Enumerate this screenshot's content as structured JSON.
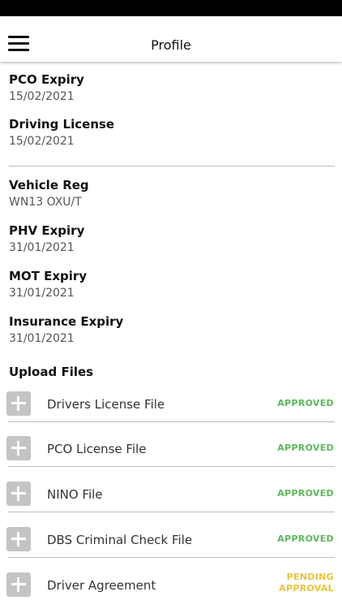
{
  "header": {
    "title": "Profile"
  },
  "driver_fields": [
    {
      "label": "PCO Expiry",
      "value": "15/02/2021"
    },
    {
      "label": "Driving License",
      "value": "15/02/2021"
    }
  ],
  "vehicle_fields": [
    {
      "label": "Vehicle Reg",
      "value": "WN13 OXU/T"
    },
    {
      "label": "PHV Expiry",
      "value": "31/01/2021"
    },
    {
      "label": "MOT Expiry",
      "value": "31/01/2021"
    },
    {
      "label": "Insurance Expiry",
      "value": "31/01/2021"
    }
  ],
  "upload": {
    "title": "Upload Files",
    "files": [
      {
        "name": "Drivers License File",
        "status": "APPROVED"
      },
      {
        "name": "PCO License File",
        "status": "APPROVED"
      },
      {
        "name": "NINO File",
        "status": "APPROVED"
      },
      {
        "name": "DBS Criminal Check File",
        "status": "APPROVED"
      },
      {
        "name": "Driver Agreement",
        "status_line1": "PENDING",
        "status_line2": "APPROVAL"
      }
    ]
  },
  "colors": {
    "approved": "#5cb85c",
    "pending": "#e8c33a",
    "plus_box": "#c4c4c4"
  }
}
